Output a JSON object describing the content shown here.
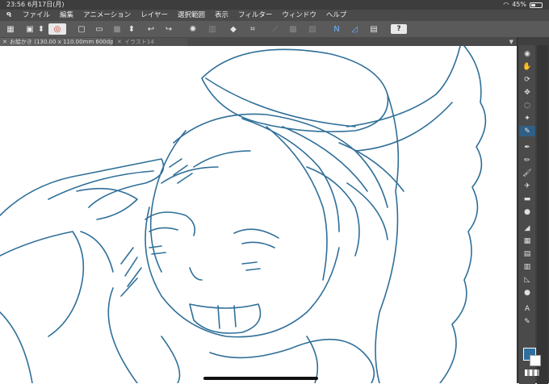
{
  "status": {
    "time": "23:56",
    "date": "6月17日(月)",
    "battery": "45%",
    "battery_level": 0.45
  },
  "menu": {
    "items": [
      "ファイル",
      "編集",
      "アニメーション",
      "レイヤー",
      "選択範囲",
      "表示",
      "フィルター",
      "ウィンドウ",
      "ヘルプ"
    ]
  },
  "tabs": [
    {
      "label": "お絵かき (130.00 x 110.00mm 600dpi 174.9%)",
      "active": true
    },
    {
      "label": "イラスト14",
      "active": false
    }
  ],
  "help_label": "?",
  "colors": {
    "accent": "#2e6fa0",
    "line": "#2f6f99",
    "toolbar": "#5a5a5a",
    "menubar": "#4a4a4a"
  },
  "command_icons": [
    "grid-icon",
    "save-icon",
    "dropdown-icon",
    "logo-toggle-icon",
    "new-icon",
    "open-icon",
    "fill-icon",
    "stepper-icon",
    "undo-icon",
    "redo-icon",
    "spinner-icon",
    "transform-icon",
    "clear-icon",
    "crop-icon",
    "ruler-icon",
    "grid2-icon",
    "pen-icon",
    "fold-icon",
    "layer-icon",
    "help-icon"
  ],
  "tool_icons": [
    "zoom-icon",
    "hand-icon",
    "rotate-icon",
    "move-icon",
    "lasso-icon",
    "wand-icon",
    "eyedropper-icon",
    "pen-tool-icon",
    "pencil-icon",
    "brush-icon",
    "airbrush-icon",
    "eraser-icon",
    "blend-icon",
    "fill-tool-icon",
    "gradient-icon",
    "figure-icon",
    "frame-icon",
    "text-icon",
    "balloon-icon",
    "ruler-tool-icon",
    "correct-icon",
    "dot-icon"
  ]
}
